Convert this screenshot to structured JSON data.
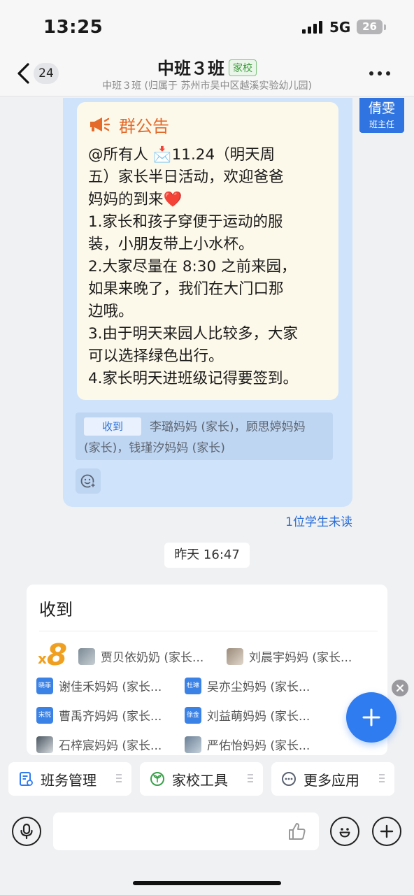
{
  "status_bar": {
    "time": "13:25",
    "network": "5G",
    "battery": "26"
  },
  "nav": {
    "back_count": "24",
    "title": "中班３班",
    "tag": "家校",
    "subtitle": "中班３班 (归属于 苏州市吴中区越溪实验幼儿园)"
  },
  "sender": {
    "name": "倩雯",
    "role": "班主任"
  },
  "notice": {
    "title": "群公告",
    "lines": [
      "@所有人 📩11.24（明天周",
      "五）家长半日活动，欢迎爸爸",
      "妈妈的到来❤️",
      "1.家长和孩子穿便于运动的服",
      "装，小朋友带上小水杯。",
      "2.大家尽量在 8:30 之前来园，",
      "如果来晚了，我们在大门口那",
      "边哦。",
      "3.由于明天来园人比较多，大家",
      "可以选择绿色出行。",
      "4.家长明天进班级记得要签到。"
    ]
  },
  "receipts": {
    "button": "收到",
    "names": "李璐妈妈 (家长)，顾思婷妈妈 (家长)，钱瑾汐妈妈 (家长)"
  },
  "unread_note": "1位学生未读",
  "timestamp": "昨天 16:47",
  "reply_card": {
    "title": "收到",
    "count_prefix": "x",
    "count": "8",
    "names": [
      {
        "avatar": "",
        "name": "贾贝依奶奶 (家长..."
      },
      {
        "avatar": "",
        "name": "刘晨宇妈妈 (家长..."
      },
      {
        "avatar": "晓菲",
        "name": "谢佳禾妈妈 (家长..."
      },
      {
        "avatar": "杜琳",
        "name": "吴亦尘妈妈 (家长..."
      },
      {
        "avatar": "宋悦",
        "name": "曹禹齐妈妈 (家长..."
      },
      {
        "avatar": "徐金",
        "name": "刘益萌妈妈 (家长..."
      },
      {
        "avatar": "",
        "name": "石梓宸妈妈 (家长..."
      },
      {
        "avatar": "",
        "name": "严佑怡妈妈 (家长..."
      }
    ]
  },
  "shortcuts": [
    {
      "icon": "class-management-icon",
      "label": "班务管理"
    },
    {
      "icon": "home-school-tools-icon",
      "label": "家校工具"
    },
    {
      "icon": "more-apps-icon",
      "label": "更多应用"
    }
  ],
  "colors": {
    "accent": "#2f7bf0",
    "notice_title": "#e46a2b",
    "count": "#f0a020",
    "bubble": "#cfe3fb"
  }
}
